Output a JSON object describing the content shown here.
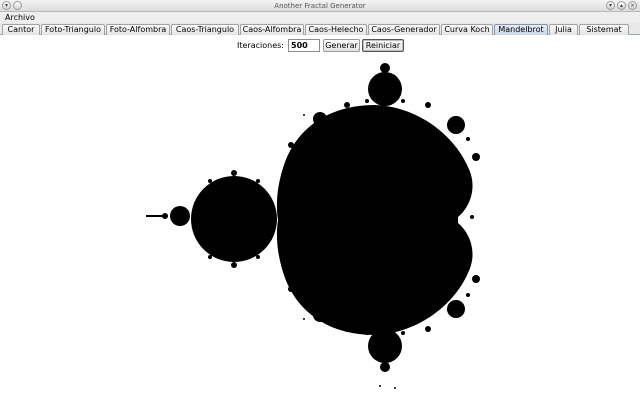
{
  "window": {
    "title": "Another Fractal Generator"
  },
  "menubar": {
    "items": [
      "Archivo"
    ]
  },
  "tabs": [
    {
      "label": "Cantor",
      "active": false
    },
    {
      "label": "Foto-Triangulo",
      "active": false
    },
    {
      "label": "Foto-Alfombra",
      "active": false
    },
    {
      "label": "Caos-Triangulo",
      "active": false
    },
    {
      "label": "Caos-Alfombra",
      "active": false
    },
    {
      "label": "Caos-Helecho",
      "active": false
    },
    {
      "label": "Caos-Generador",
      "active": false
    },
    {
      "label": "Curva Koch",
      "active": false
    },
    {
      "label": "Mandelbrot",
      "active": true
    },
    {
      "label": "Julia",
      "active": false
    },
    {
      "label": "Sistemat",
      "active": false
    }
  ],
  "controls": {
    "iterations_label": "Iteraciones:",
    "iterations_value": "500",
    "generate_label": "Generar",
    "reset_label": "Reiniciar"
  },
  "icons": {
    "window_menu": "window-menu-icon",
    "minimize": "minimize-icon",
    "maximize": "maximize-icon",
    "close": "close-icon"
  },
  "fractal": {
    "type": "mandelbrot",
    "fill_color": "#000000",
    "background": "#ffffff"
  }
}
